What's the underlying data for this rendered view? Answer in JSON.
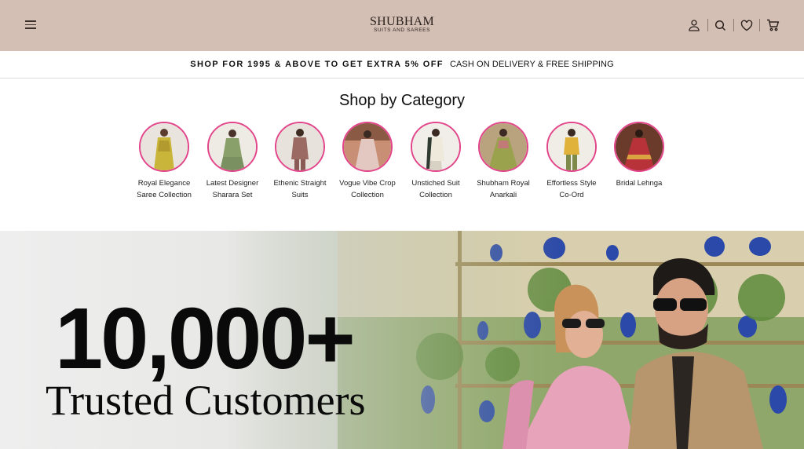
{
  "header": {
    "brand_name": "SHUBHAM",
    "brand_tagline": "SUITS AND SAREES",
    "icons": [
      "menu-icon",
      "account-icon",
      "search-icon",
      "wishlist-icon",
      "cart-icon"
    ],
    "background_color": "#d4bfb4"
  },
  "announcement": {
    "promo_text": "SHOP FOR 1995 & ABOVE TO GET EXTRA 5% OFF",
    "shipping_text": "CASH ON DELIVERY & FREE SHIPPING"
  },
  "categories": {
    "title": "Shop by Category",
    "ring_color": "#e2458a",
    "items": [
      {
        "line1": "Royal Elegance",
        "line2": "Saree Collection"
      },
      {
        "line1": "Latest Designer",
        "line2": "Sharara Set"
      },
      {
        "line1": "Ethenic Straight",
        "line2": "Suits"
      },
      {
        "line1": "Vogue Vibe Crop",
        "line2": "Collection"
      },
      {
        "line1": "Unstiched Suit",
        "line2": "Collection"
      },
      {
        "line1": "Shubham Royal",
        "line2": "Anarkali"
      },
      {
        "line1": "Effortless Style",
        "line2": "Co-Ord"
      },
      {
        "line1": "Bridal Lehnga",
        "line2": ""
      }
    ]
  },
  "hero": {
    "number": "10,000+",
    "text": "Trusted Customers"
  }
}
